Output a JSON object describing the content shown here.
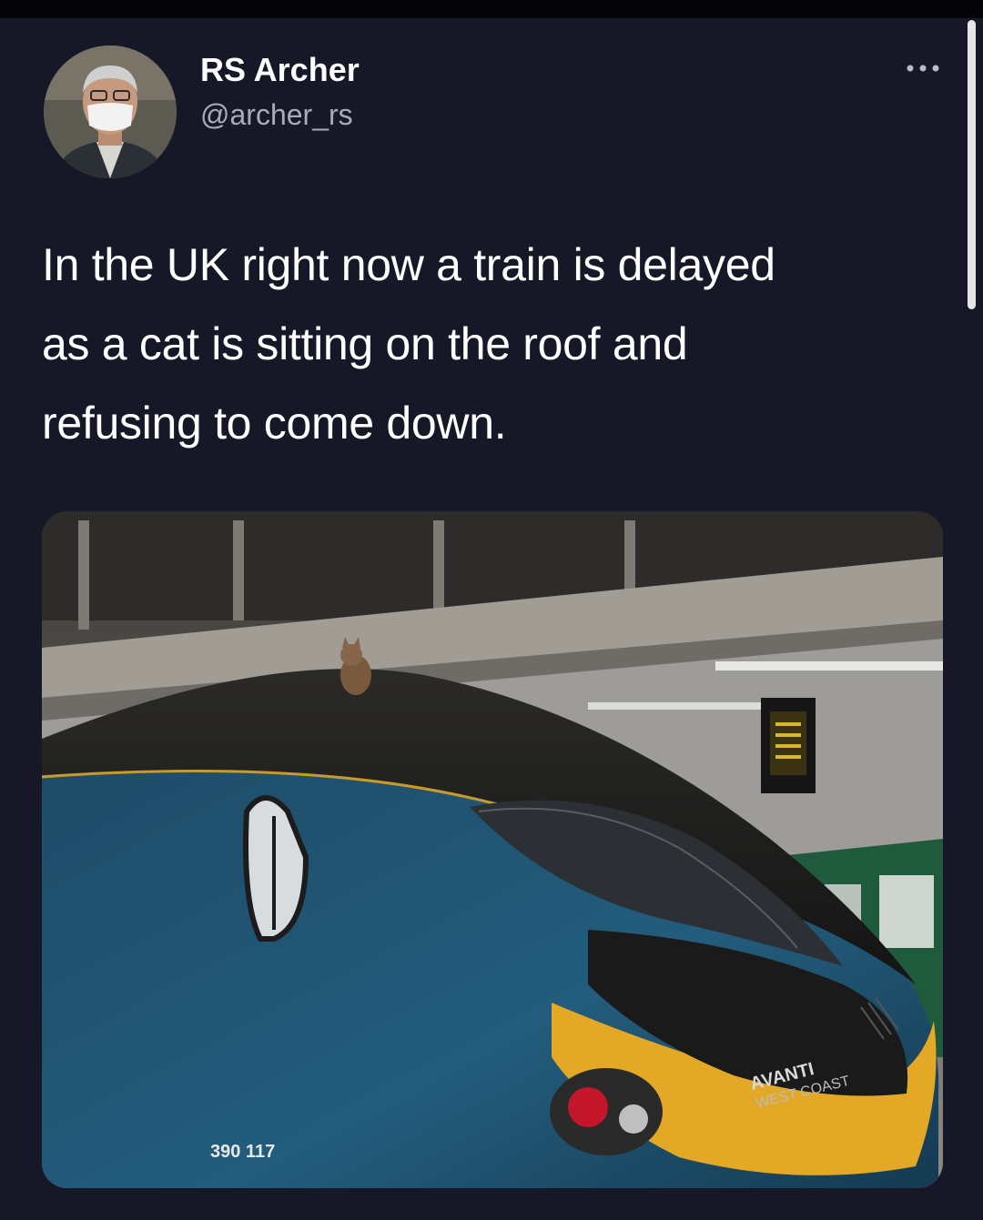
{
  "tweet": {
    "author_name": "RS Archer",
    "author_handle": "@archer_rs",
    "text_lines": [
      "In the UK right now a train is delayed",
      "as a cat is sitting on the roof and",
      "refusing to come down."
    ]
  },
  "media": {
    "train_number": "390 117",
    "brand_line1": "AVANTI",
    "brand_line2": "WEST COAST"
  },
  "icons": {
    "more": "more-options-icon",
    "avatar": "profile-avatar"
  },
  "colors": {
    "background": "#161827",
    "text": "#ffffff",
    "handle": "#a7acb8",
    "train_body": "#1f4f6b",
    "train_nose_stripe": "#e2a826"
  }
}
